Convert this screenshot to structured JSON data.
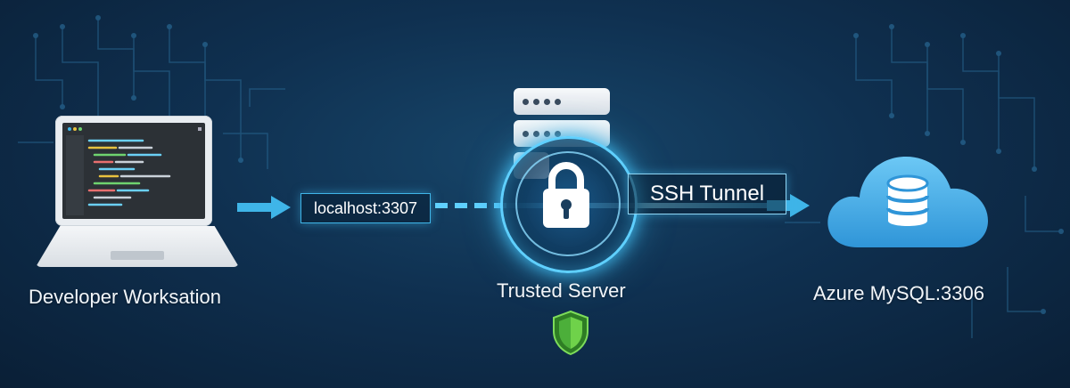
{
  "nodes": {
    "developer": {
      "label": "Developer Worksation",
      "icon": "laptop-icon"
    },
    "trusted": {
      "label": "Trusted Server",
      "icon": "server-stack-icon"
    },
    "azure": {
      "label": "Azure MySQL:3306",
      "icon": "cloud-database-icon"
    }
  },
  "connections": {
    "local_port_label": "localhost:3307",
    "tunnel_label": "SSH Tunnel"
  },
  "colors": {
    "accent": "#3fb5e8",
    "cloud": "#3aa6e6",
    "shield": "#4caf3a",
    "background": "#0f3050"
  }
}
